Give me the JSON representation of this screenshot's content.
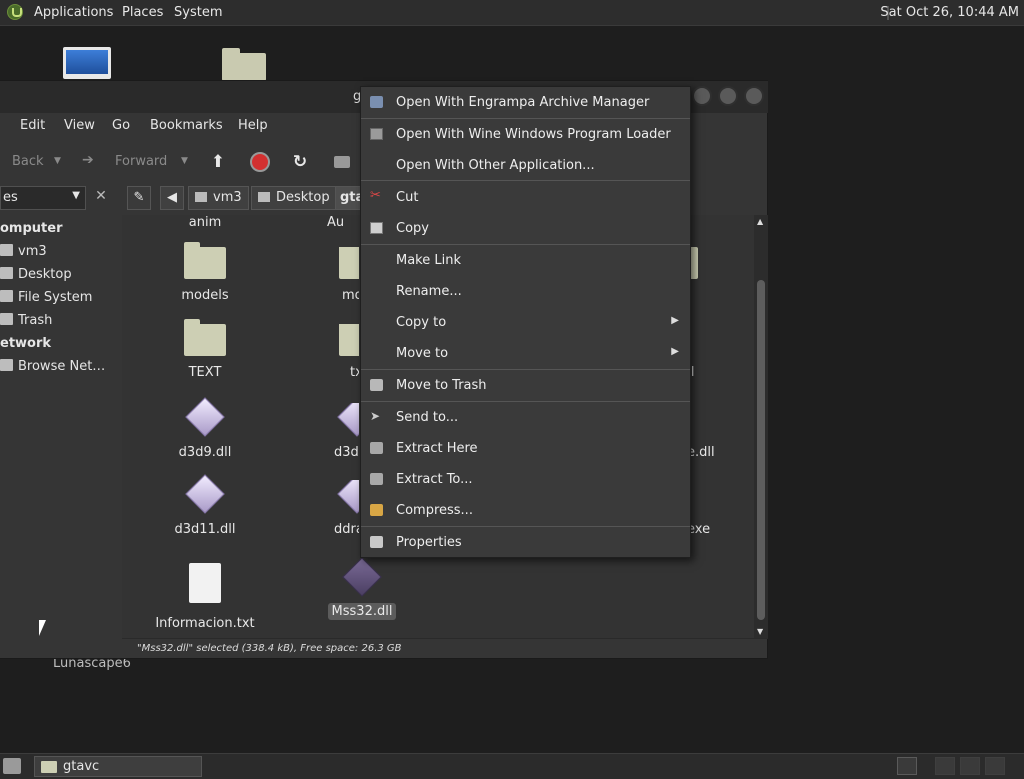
{
  "top_panel": {
    "applications": "Applications",
    "places": "Places",
    "system": "System",
    "clock": "Sat Oct 26, 10:44 AM"
  },
  "desktop": {
    "label": "Lunascape6"
  },
  "window": {
    "title_fragment": "g",
    "menu": [
      "Edit",
      "View",
      "Go",
      "Bookmarks",
      "Help"
    ],
    "toolbar": {
      "back": "Back",
      "forward": "Forward"
    },
    "location": {
      "combo_text": "es",
      "crumbs": [
        "vm3",
        "Desktop",
        "gta"
      ]
    },
    "sidebar": {
      "computer_header": "omputer",
      "computer_items": [
        "vm3",
        "Desktop",
        "File System",
        "Trash"
      ],
      "network_header": "etwork",
      "network_items": [
        "Browse Net…"
      ]
    },
    "files": [
      {
        "name": "anim",
        "type": "folder-label"
      },
      {
        "name": "Au",
        "type": "folder-label"
      },
      {
        "name": "models",
        "type": "folder"
      },
      {
        "name": "mo",
        "type": "folder"
      },
      {
        "name": "s",
        "type": "folder"
      },
      {
        "name": "TEXT",
        "type": "folder"
      },
      {
        "name": "tx",
        "type": "folder"
      },
      {
        "name": "dll",
        "type": "dll"
      },
      {
        "name": "d3d9.dll",
        "type": "dll"
      },
      {
        "name": "d3d",
        "type": "dll"
      },
      {
        "name": "e.dll",
        "type": "dll"
      },
      {
        "name": "d3d11.dll",
        "type": "dll"
      },
      {
        "name": "ddra",
        "type": "dll"
      },
      {
        "name": "exe",
        "type": "exe"
      },
      {
        "name": "Informacion.txt",
        "type": "txt"
      },
      {
        "name": "Mss32.dll",
        "type": "dll-selected"
      }
    ],
    "status": "\"Mss32.dll\" selected (338.4 kB), Free space: 26.3 GB"
  },
  "context_menu": {
    "items": [
      {
        "label": "Open With Engrampa Archive Manager",
        "icon": "archive-manager-icon"
      },
      {
        "label": "Open With Wine Windows Program Loader",
        "icon": "wine-icon"
      },
      {
        "label": "Open With Other Application...",
        "icon": ""
      },
      {
        "label": "Cut",
        "icon": "scissors-icon"
      },
      {
        "label": "Copy",
        "icon": "copy-icon"
      },
      {
        "label": "Make Link",
        "icon": ""
      },
      {
        "label": "Rename...",
        "icon": ""
      },
      {
        "label": "Copy to",
        "icon": "",
        "submenu": true
      },
      {
        "label": "Move to",
        "icon": "",
        "submenu": true
      },
      {
        "label": "Move to Trash",
        "icon": "trash-icon"
      },
      {
        "label": "Send to...",
        "icon": "send-icon"
      },
      {
        "label": "Extract Here",
        "icon": "extract-icon"
      },
      {
        "label": "Extract To...",
        "icon": "extract-icon"
      },
      {
        "label": "Compress...",
        "icon": "compress-icon"
      },
      {
        "label": "Properties",
        "icon": "properties-icon"
      }
    ]
  },
  "taskbar": {
    "task": "gtavc"
  },
  "colors": {
    "panel": "#2d2d2d",
    "window": "#353535",
    "menu": "#3a3a3a",
    "folder": "#cdcfb4",
    "record_red": "#d23030"
  }
}
